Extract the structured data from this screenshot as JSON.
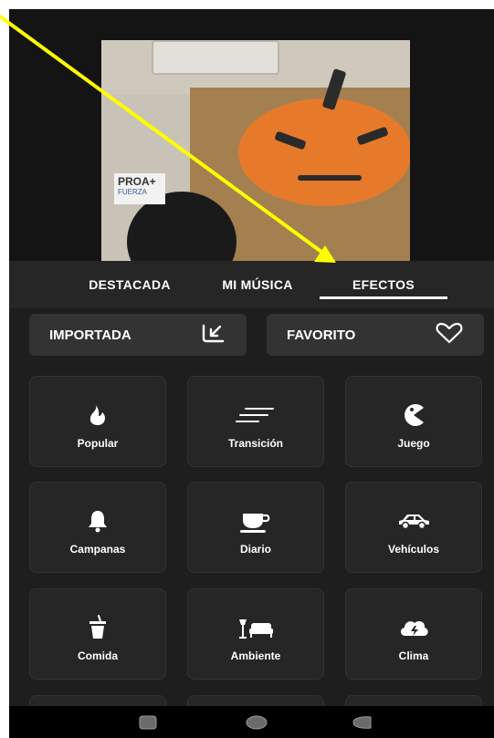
{
  "photo_sign": {
    "line1": "PROA+",
    "line2": "FUERZA"
  },
  "tabs": [
    {
      "label": "DESTACADA"
    },
    {
      "label": "MI MÚSICA"
    },
    {
      "label": "EFECTOS",
      "selected": true
    }
  ],
  "quick_buttons": [
    {
      "label": "IMPORTADA",
      "icon": "import-icon"
    },
    {
      "label": "FAVORITO",
      "icon": "heart-icon"
    }
  ],
  "categories": [
    {
      "label": "Popular",
      "icon": "flame-icon"
    },
    {
      "label": "Transición",
      "icon": "speed-lines-icon"
    },
    {
      "label": "Juego",
      "icon": "pacman-icon"
    },
    {
      "label": "Campanas",
      "icon": "bell-icon"
    },
    {
      "label": "Diario",
      "icon": "cup-icon"
    },
    {
      "label": "Vehículos",
      "icon": "car-icon"
    },
    {
      "label": "Comida",
      "icon": "drink-icon"
    },
    {
      "label": "Ambiente",
      "icon": "sofa-lamp-icon"
    },
    {
      "label": "Clima",
      "icon": "storm-cloud-icon"
    }
  ],
  "colors": {
    "background": "#1e1e1e",
    "tile": "#262626",
    "pill": "#333333",
    "annotation_arrow": "#ffff00"
  }
}
